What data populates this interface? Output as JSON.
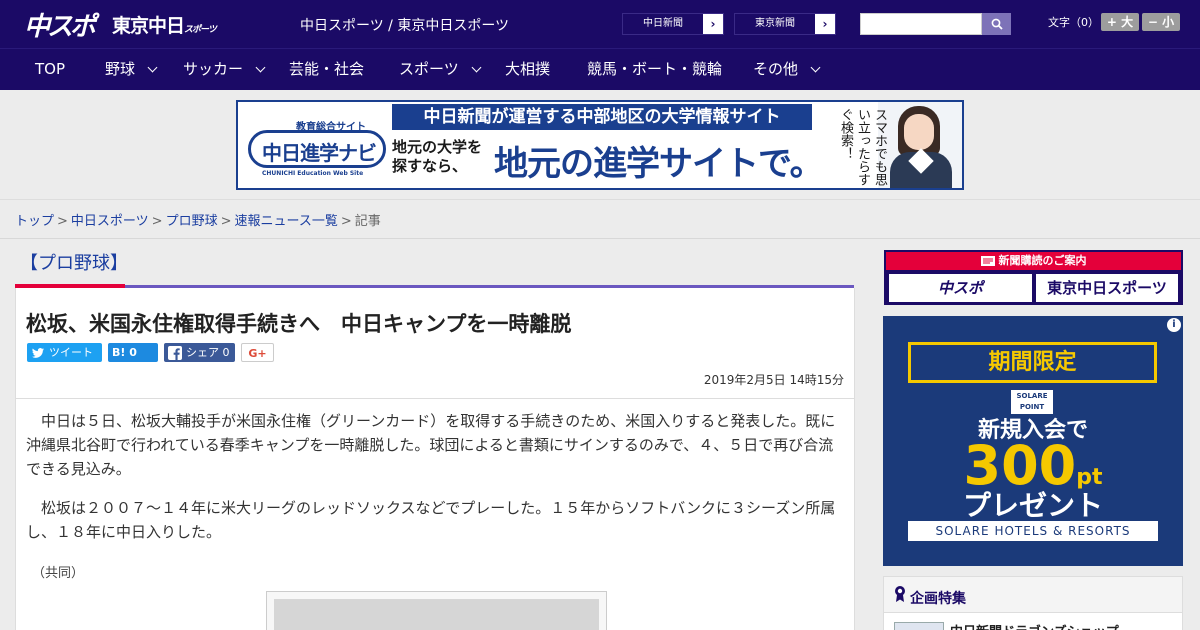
{
  "header": {
    "logo_chuspo": "中スポ",
    "logo_tokyo": "東京中日",
    "logo_tokyo_small": "スポーツ",
    "site_names": "中日スポーツ / 東京中日スポーツ",
    "paper_links": [
      {
        "label": "中日新聞",
        "arrow": "›"
      },
      {
        "label": "東京新聞",
        "arrow": "›"
      }
    ],
    "search_placeholder": "",
    "font_size_label": "文字（0）",
    "size_up": "+ 大",
    "size_down": "− 小"
  },
  "nav": {
    "items": [
      {
        "label": "TOP",
        "dropdown": false
      },
      {
        "label": "野球",
        "dropdown": true
      },
      {
        "label": "サッカー",
        "dropdown": true
      },
      {
        "label": "芸能・社会",
        "dropdown": false
      },
      {
        "label": "スポーツ",
        "dropdown": true
      },
      {
        "label": "大相撲",
        "dropdown": false
      },
      {
        "label": "競馬・ボート・競輪",
        "dropdown": false
      },
      {
        "label": "その他",
        "dropdown": true
      }
    ]
  },
  "banner": {
    "caption": "教育総合サイト",
    "logo_name": "中日進学ナビ",
    "logo_en": "CHUNICHI Education Web Site",
    "top_text": "中日新聞が運営する中部地区の大学情報サイト",
    "sub_line1": "地元の大学を",
    "sub_line2": "探すなら、",
    "main_text": "地元の進学サイトで。",
    "vertical_text": "スマホでも思い立ったらすぐ検索！"
  },
  "breadcrumb": {
    "items": [
      "トップ",
      "中日スポーツ",
      "プロ野球",
      "速報ニュース一覧"
    ],
    "current": "記事",
    "separator": ">"
  },
  "article": {
    "category": "【プロ野球】",
    "title": "松坂、米国永住権取得手続きへ　中日キャンプを一時離脱",
    "share": {
      "tweet": "ツイート",
      "hatena_icon": "B!",
      "hatena_count": "0",
      "facebook": "シェア",
      "facebook_count": "0",
      "gplus": "G+"
    },
    "date": "2019年2月5日 14時15分",
    "paragraphs": [
      "中日は５日、松坂大輔投手が米国永住権（グリーンカード）を取得する手続きのため、米国入りすると発表した。既に沖縄県北谷町で行われている春季キャンプを一時離脱した。球団によると書類にサインするのみで、４、５日で再び合流できる見込み。",
      "松坂は２００７～１４年に米大リーグのレッドソックスなどでプレーした。１５年からソフトバンクに３シーズン所属し、１８年に中日入りした。"
    ],
    "credit": "（共同）"
  },
  "sidebar": {
    "subscribe_head": "新聞購読のご案内",
    "subscribe_logo_a": "中スポ",
    "subscribe_logo_b": "東京中日スポーツ",
    "ad": {
      "limited": "期間限定",
      "point_badge": "SOLARE POINT",
      "new_member": "新規入会で",
      "amount": "300",
      "unit": "pt",
      "present": "プレゼント",
      "brand": "SOLARE HOTELS & RESORTS",
      "info_icon": "i"
    },
    "kikaku_title": "企画特集",
    "kikaku_item": "中日新聞ドラゴンズショップ"
  },
  "colors": {
    "header_bg": "#1b0a66",
    "accent_red": "#e4003a",
    "link_blue": "#1b3ea0",
    "twitter": "#1da1f2",
    "hatena": "#1d8ae0",
    "facebook": "#3b5998"
  }
}
